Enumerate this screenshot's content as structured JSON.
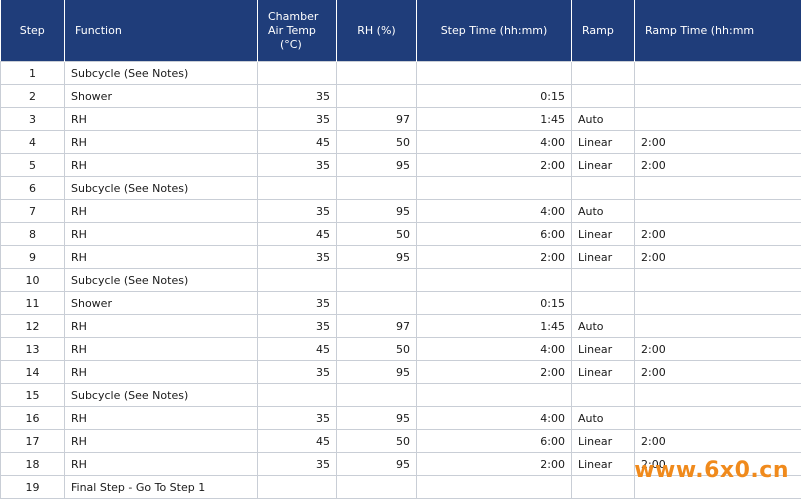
{
  "table": {
    "headers": {
      "step": "Step",
      "function": "Function",
      "temp_line1": "Chamber",
      "temp_line2": "Air Temp",
      "temp_line3": "(°C)",
      "rh": "RH (%)",
      "step_time": "Step Time (hh:mm)",
      "ramp": "Ramp",
      "ramp_time": "Ramp Time (hh:mm"
    },
    "rows": [
      {
        "step": "1",
        "function": "Subcycle (See Notes)",
        "temp": "",
        "rh": "",
        "time": "",
        "ramp": "",
        "ramp_time": ""
      },
      {
        "step": "2",
        "function": "Shower",
        "temp": "35",
        "rh": "",
        "time": "0:15",
        "ramp": "",
        "ramp_time": ""
      },
      {
        "step": "3",
        "function": "RH",
        "temp": "35",
        "rh": "97",
        "time": "1:45",
        "ramp": "Auto",
        "ramp_time": ""
      },
      {
        "step": "4",
        "function": "RH",
        "temp": "45",
        "rh": "50",
        "time": "4:00",
        "ramp": "Linear",
        "ramp_time": "2:00"
      },
      {
        "step": "5",
        "function": "RH",
        "temp": "35",
        "rh": "95",
        "time": "2:00",
        "ramp": "Linear",
        "ramp_time": "2:00"
      },
      {
        "step": "6",
        "function": "Subcycle (See Notes)",
        "temp": "",
        "rh": "",
        "time": "",
        "ramp": "",
        "ramp_time": ""
      },
      {
        "step": "7",
        "function": "RH",
        "temp": "35",
        "rh": "95",
        "time": "4:00",
        "ramp": "Auto",
        "ramp_time": ""
      },
      {
        "step": "8",
        "function": "RH",
        "temp": "45",
        "rh": "50",
        "time": "6:00",
        "ramp": "Linear",
        "ramp_time": "2:00"
      },
      {
        "step": "9",
        "function": "RH",
        "temp": "35",
        "rh": "95",
        "time": "2:00",
        "ramp": "Linear",
        "ramp_time": "2:00"
      },
      {
        "step": "10",
        "function": "Subcycle (See Notes)",
        "temp": "",
        "rh": "",
        "time": "",
        "ramp": "",
        "ramp_time": ""
      },
      {
        "step": "11",
        "function": "Shower",
        "temp": "35",
        "rh": "",
        "time": "0:15",
        "ramp": "",
        "ramp_time": ""
      },
      {
        "step": "12",
        "function": "RH",
        "temp": "35",
        "rh": "97",
        "time": "1:45",
        "ramp": "Auto",
        "ramp_time": ""
      },
      {
        "step": "13",
        "function": "RH",
        "temp": "45",
        "rh": "50",
        "time": "4:00",
        "ramp": "Linear",
        "ramp_time": "2:00"
      },
      {
        "step": "14",
        "function": "RH",
        "temp": "35",
        "rh": "95",
        "time": "2:00",
        "ramp": "Linear",
        "ramp_time": "2:00"
      },
      {
        "step": "15",
        "function": "Subcycle (See Notes)",
        "temp": "",
        "rh": "",
        "time": "",
        "ramp": "",
        "ramp_time": ""
      },
      {
        "step": "16",
        "function": "RH",
        "temp": "35",
        "rh": "95",
        "time": "4:00",
        "ramp": "Auto",
        "ramp_time": ""
      },
      {
        "step": "17",
        "function": "RH",
        "temp": "45",
        "rh": "50",
        "time": "6:00",
        "ramp": "Linear",
        "ramp_time": "2:00"
      },
      {
        "step": "18",
        "function": "RH",
        "temp": "35",
        "rh": "95",
        "time": "2:00",
        "ramp": "Linear",
        "ramp_time": "2:00"
      },
      {
        "step": "19",
        "function": "Final Step - Go To Step 1",
        "temp": "",
        "rh": "",
        "time": "",
        "ramp": "",
        "ramp_time": ""
      }
    ]
  },
  "watermark": "www.6x0.cn",
  "colors": {
    "header_bg": "#1f3d7a",
    "header_text": "#ffffff",
    "grid": "#c9ced6",
    "watermark": "#f08a1c"
  }
}
